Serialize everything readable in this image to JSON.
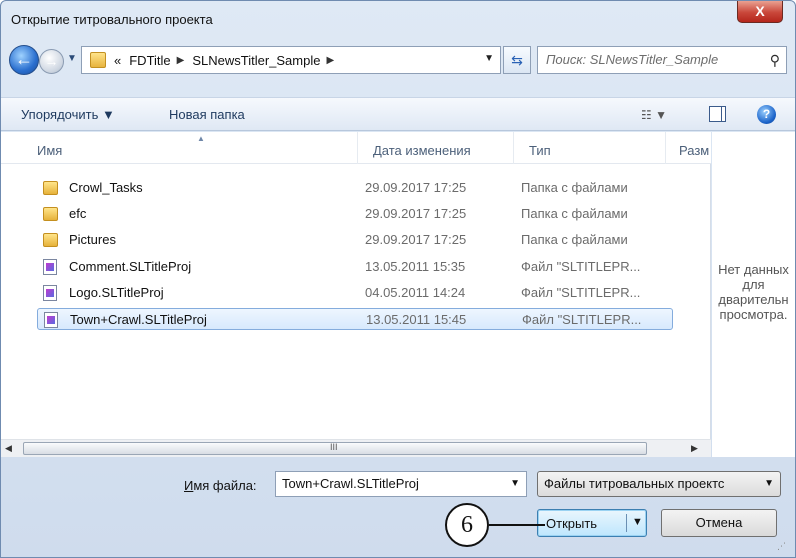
{
  "window": {
    "title": "Открытие титровального проекта",
    "close_glyph": "X"
  },
  "nav": {
    "back_glyph": "←",
    "fwd_glyph": "→",
    "breadcrumb_prefix": "«",
    "breadcrumbs": [
      "FDTitle",
      "SLNewsTitler_Sample"
    ],
    "search_placeholder": "Поиск: SLNewsTitler_Sample"
  },
  "toolbar": {
    "organize": "Упорядочить ▼",
    "new_folder": "Новая папка",
    "help_glyph": "?"
  },
  "columns": {
    "name": "Имя",
    "date": "Дата изменения",
    "type": "Тип",
    "size": "Разм"
  },
  "files": [
    {
      "name": "Crowl_Tasks",
      "date": "29.09.2017 17:25",
      "type": "Папка с файлами",
      "kind": "folder"
    },
    {
      "name": "efc",
      "date": "29.09.2017 17:25",
      "type": "Папка с файлами",
      "kind": "folder"
    },
    {
      "name": "Pictures",
      "date": "29.09.2017 17:25",
      "type": "Папка с файлами",
      "kind": "folder"
    },
    {
      "name": "Comment.SLTitleProj",
      "date": "13.05.2011 15:35",
      "type": "Файл \"SLTITLEPR...",
      "kind": "file"
    },
    {
      "name": "Logo.SLTitleProj",
      "date": "04.05.2011 14:24",
      "type": "Файл \"SLTITLEPR...",
      "kind": "file"
    },
    {
      "name": "Town+Crawl.SLTitleProj",
      "date": "13.05.2011 15:45",
      "type": "Файл \"SLTITLEPR...",
      "kind": "file",
      "selected": true
    }
  ],
  "preview": {
    "line1": "Нет данных",
    "line2": "для",
    "line3": "дварительн",
    "line4": "просмотра."
  },
  "scrollbar": {
    "grip": "III"
  },
  "bottom": {
    "filename_label_u": "И",
    "filename_label_rest": "мя файла:",
    "filename_value": "Town+Crawl.SLTitleProj",
    "filetype_value": "Файлы титровальных проектс",
    "open_label": "Открыть",
    "cancel_label": "Отмена"
  },
  "callout": {
    "number": "6"
  }
}
